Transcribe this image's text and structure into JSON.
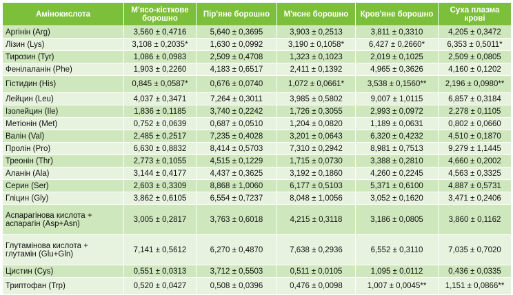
{
  "table": {
    "headers": [
      "Амінокислота",
      "М'ясо-кісткове борошно",
      "Пір'яне борошно",
      "М'ясне борошно",
      "Кров'яне борошно",
      "Суха плазма крові"
    ],
    "rows": [
      {
        "name": "Аргінін (Arg)",
        "values": [
          "3,560 ± 0,4716",
          "5,640 ± 0,3695",
          "3,903 ± 0,2513",
          "3,811 ± 0,3310",
          "4,205 ± 0,3472"
        ]
      },
      {
        "name": "Лізин (Lys)",
        "values": [
          "3,108 ± 0,2035*",
          "1,630 ± 0,0992",
          "3,190 ± 0,1058*",
          "6,427 ± 0,2660*",
          "6,353 ± 0,5011*"
        ]
      },
      {
        "name": "Тирозин (Tyr)",
        "values": [
          "1,086 ± 0,0983",
          "2,509 ± 0,4708",
          "1,323 ± 0,1023",
          "2,019 ± 0,1025",
          "2,509 ± 0,0805"
        ]
      },
      {
        "name": "Фенілаланін (Phe)",
        "values": [
          "1,903 ± 0,2260",
          "4,183 ± 0,6517",
          "2,411 ± 0,1392",
          "4,965 ± 0,3626",
          "4,160 ± 0,1202"
        ]
      },
      {
        "name": "Гістидин (His)",
        "values": [
          "0,845 ± 0,0587*",
          "0,676 ± 0,0740",
          "1,072 ± 0,0661*",
          "3,538 ± 0,1560**",
          "2,196 ± 0,0980**"
        ]
      },
      {
        "name": "Лейцин (Leu)",
        "values": [
          "4,037 ± 0,3471",
          "7,264 ± 0,3011",
          "3,985 ± 0,5802",
          "9,007 ± 1,0115",
          "6,857 ± 0,3184"
        ]
      },
      {
        "name": "Ізолейцин (Ile)",
        "values": [
          "1,836 ± 0,1185",
          "3,740 ± 0,2242",
          "1,726 ± 0,3055",
          "2,993 ± 0,0972",
          "2,278 ± 0,1105"
        ]
      },
      {
        "name": "Метіонін (Met)",
        "values": [
          "0,752 ± 0,0639",
          "0,687 ± 0,0510",
          "1,204 ± 0,0820",
          "1,189 ± 0,0631",
          "0,802 ± 0,0660"
        ]
      },
      {
        "name": "Валін (Val)",
        "values": [
          "2,485 ± 0,2517",
          "7,235 ± 0,4028",
          "3,201 ± 0,0643",
          "6,320 ± 0,4232",
          "4,510 ± 0,1870"
        ]
      },
      {
        "name": "Пролін (Pro)",
        "values": [
          "6,630 ± 0,8832",
          "8,414 ± 0,5703",
          "7,310 ± 0,2942",
          "8,981 ± 0,7513",
          "9,279 ± 1,1445"
        ]
      },
      {
        "name": "Треонін (Thr)",
        "values": [
          "2,773 ± 0,1055",
          "4,515 ± 0,1229",
          "1,715 ± 0,0730",
          "3,388 ± 0,2810",
          "4,660 ± 0,2002"
        ]
      },
      {
        "name": "Аланін (Ala)",
        "values": [
          "3,144 ± 0,4177",
          "4,437 ± 0,3625",
          "3,192 ± 0,1860",
          "4,260 ± 0,2245",
          "4,563 ± 0,3325"
        ]
      },
      {
        "name": "Серин (Ser)",
        "values": [
          "2,603 ± 0,3309",
          "8,868 ± 1,0060",
          "6,177 ± 0,5103",
          "5,371 ± 0,6100",
          "4,887 ± 0,5731"
        ]
      },
      {
        "name": "Гліцин (Gly)",
        "values": [
          "3,862 ± 0,6105",
          "6,554 ± 0,7237",
          "8,048 ± 1,0056",
          "3,052 ± 0,1620",
          "3,471 ± 0,2406"
        ]
      },
      {
        "name": "Аспарагінова кислота + аспарагін (Asp+Asn)",
        "values": [
          "3,005 ± 0,2817",
          "3,763 ± 0,6018",
          "4,215 ± 0,3118",
          "3,186 ± 0,0805",
          "3,860 ± 0,1162"
        ]
      },
      {
        "name": "Глутамінова кислота + глутамін (Glu+Gln)",
        "values": [
          "7,141 ± 0,5612",
          "6,270 ± 0,4870",
          "7,638 ± 0,2936",
          "6,552 ± 0,3110",
          "7,035 ± 0,7020"
        ]
      },
      {
        "name": "Цистин (Cys)",
        "values": [
          "0,551 ± 0,0313",
          "3,712 ± 0,5503",
          "0,511 ± 0,0105",
          "1,095 ± 0,0112",
          "0,436 ± 0,0335"
        ]
      },
      {
        "name": "Триптофан (Trp)",
        "values": [
          "0,520 ± 0,0427",
          "0,508 ± 0,0396",
          "0,476 ± 0,0098",
          "1,007 ± 0,0045**",
          "1,151 ± 0,0866**"
        ]
      }
    ]
  },
  "colors": {
    "header_bg": "#7cbf3b",
    "header_text": "#ffffff",
    "row_odd": "#cfe7bd",
    "row_even": "#e8f3df"
  }
}
